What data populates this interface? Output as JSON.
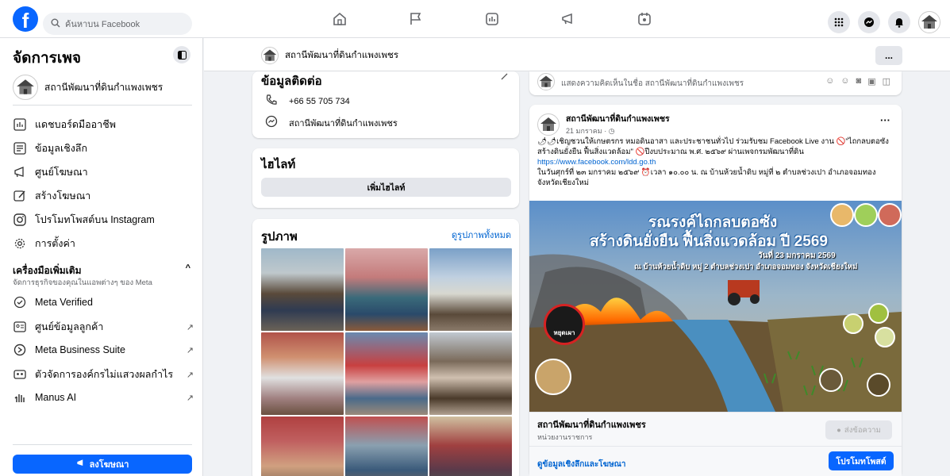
{
  "topnav": {
    "search_placeholder": "ค้นหาบน Facebook"
  },
  "sidebar": {
    "title": "จัดการเพจ",
    "page_name": "สถานีพัฒนาที่ดินกำแพงเพชร",
    "items": [
      {
        "label": "แดชบอร์ดมืออาชีพ",
        "icon": "dashboard-icon"
      },
      {
        "label": "ข้อมูลเชิงลึก",
        "icon": "insights-icon"
      },
      {
        "label": "ศูนย์โฆษณา",
        "icon": "megaphone-icon"
      },
      {
        "label": "สร้างโฆษณา",
        "icon": "pencil-icon"
      },
      {
        "label": "โปรโมทโพสต์บน Instagram",
        "icon": "instagram-icon"
      },
      {
        "label": "การตั้งค่า",
        "icon": "gear-icon"
      }
    ],
    "tools_section": {
      "title": "เครื่องมือเพิ่มเติม",
      "subtitle": "จัดการธุรกิจของคุณในแอพต่างๆ ของ Meta"
    },
    "tools": [
      {
        "label": "Meta Verified",
        "icon": "verified-icon"
      },
      {
        "label": "ศูนย์ข้อมูลลูกค้า",
        "icon": "customer-icon"
      },
      {
        "label": "Meta Business Suite",
        "icon": "business-suite-icon"
      },
      {
        "label": "ตัวจัดการองค์กรไม่แสวงผลกำไร",
        "icon": "nonprofit-icon"
      },
      {
        "label": "Manus AI",
        "icon": "manus-icon"
      }
    ],
    "promote_label": "ลงโฆษณา"
  },
  "pagebar": {
    "page_name": "สถานีพัฒนาที่ดินกำแพงเพชร",
    "more_label": "..."
  },
  "contact": {
    "title": "ข้อมูลติดต่อ",
    "phone": "+66 55 705 734",
    "messenger": "สถานีพัฒนาที่ดินกำแพงเพชร"
  },
  "highlights": {
    "title": "ไฮไลท์",
    "add_label": "เพิ่มไฮไลท์"
  },
  "photos": {
    "title": "รูปภาพ",
    "see_all": "ดูรูปภาพทั้งหมด"
  },
  "composer": {
    "placeholder": "แสดงความคิดเห็นในชื่อ สถานีพัฒนาที่ดินกำแพงเพชร"
  },
  "post": {
    "author": "สถานีพัฒนาที่ดินกำแพงเพชร",
    "date": "21 มกราคม · ",
    "line1": "🌶🌶เชิญชวนให้เกษตรกร หมอดินอาสา และประชาชนทั่วไป ร่วมรับชม Facebook Live งาน 🚫\"ไถกลบตอซัง สร้างดินยั่งยืน ฟื้นสิ่งแวดล้อม\" 🚫ปีงบประมาณ พ.ศ. ๒๕๖๙ ผ่านเพจกรมพัฒนาที่ดิน",
    "link": "https://www.facebook.com/ldd.go.th",
    "line2": "ในวันศุกร์ที่ ๒๓ มกราคม ๒๕๖๙ ⏰เวลา ๑๐.๐๐ น. ณ บ้านห้วยน้ำดิบ หมู่ที่ ๒ ตำบลช่วงเปา อำเภอจอมทอง จังหวัดเชียงใหม่",
    "banner": {
      "title1": "รณรงค์ไถกลบตอซัง",
      "title2": "สร้างดินยั่งยืน ฟื้นสิ่งแวดล้อม ปี 2569",
      "date": "วันที่ 23 มกราคม 2569",
      "place": "ณ บ้านห้วยน้ำดิบ หมู่ 2 ตำบลช่วงเปา อำเภอจอมทอง จังหวัดเชียงใหม่",
      "stop_label": "หยุดเผา"
    },
    "footer_name": "สถานีพัฒนาที่ดินกำแพงเพชร",
    "footer_sub": "หน่วยงานราชการ",
    "message_label": "ส่งข้อความ",
    "insights_link": "ดูข้อมูลเชิงลึกและโฆษณา",
    "boost_label": "โปรโมทโพสต์"
  },
  "colors": {
    "accent": "#0866ff",
    "link": "#0064d1"
  }
}
